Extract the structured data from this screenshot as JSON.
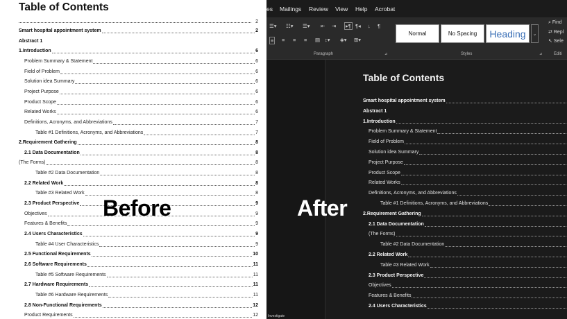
{
  "left": {
    "title": "Table of Contents",
    "top_page": "2",
    "entries": [
      {
        "text": "Smart hospital appointment system",
        "page": "2",
        "level": 0,
        "bold": true,
        "dots": true
      },
      {
        "text": "Abstract 1",
        "page": "",
        "level": 0,
        "bold": true,
        "dots": false
      },
      {
        "text": "1.Introduction",
        "page": "6",
        "level": 0,
        "bold": true,
        "dots": true
      },
      {
        "text": "Problem Summary & Statement",
        "page": "6",
        "level": 1,
        "bold": false,
        "dots": true
      },
      {
        "text": "Field of Problem",
        "page": "6",
        "level": 1,
        "bold": false,
        "dots": true
      },
      {
        "text": "Solution idea Summary",
        "page": "6",
        "level": 1,
        "bold": false,
        "dots": true
      },
      {
        "text": "Project Purpose",
        "page": "6",
        "level": 1,
        "bold": false,
        "dots": true
      },
      {
        "text": "Product Scope",
        "page": "6",
        "level": 1,
        "bold": false,
        "dots": true
      },
      {
        "text": "Related Works",
        "page": "6",
        "level": 1,
        "bold": false,
        "dots": true
      },
      {
        "text": "Definitions, Acronyms, and Abbreviations",
        "page": "7",
        "level": 1,
        "bold": false,
        "dots": true
      },
      {
        "text": "Table #1 Definitions, Acronyms, and Abbreviations",
        "page": "7",
        "level": 2,
        "bold": false,
        "dots": true
      },
      {
        "text": "2.Requirement Gathering",
        "page": "8",
        "level": 0,
        "bold": true,
        "dots": true
      },
      {
        "text": "2.1  Data Documentation",
        "page": "8",
        "level": 1,
        "bold": true,
        "dots": true
      },
      {
        "text": "(The Forms)",
        "page": "8",
        "level": 0,
        "bold": false,
        "dots": true
      },
      {
        "text": "Table #2  Data Documentation",
        "page": "8",
        "level": 2,
        "bold": false,
        "dots": true
      },
      {
        "text": "2.2  Related Work",
        "page": "8",
        "level": 1,
        "bold": true,
        "dots": true
      },
      {
        "text": "Table #3  Related Work",
        "page": "8",
        "level": 2,
        "bold": false,
        "dots": true
      },
      {
        "text": "2.3  Product Perspective",
        "page": "9",
        "level": 1,
        "bold": true,
        "dots": true
      },
      {
        "text": "Objectives",
        "page": "9",
        "level": 1,
        "bold": false,
        "dots": true
      },
      {
        "text": "Features & Benefits",
        "page": "9",
        "level": 1,
        "bold": false,
        "dots": true
      },
      {
        "text": "2.4  Users Characteristics",
        "page": "9",
        "level": 1,
        "bold": true,
        "dots": true
      },
      {
        "text": "Table #4  User Characteristics",
        "page": "9",
        "level": 2,
        "bold": false,
        "dots": true
      },
      {
        "text": "2.5  Functional Requirements",
        "page": "10",
        "level": 1,
        "bold": true,
        "dots": true
      },
      {
        "text": "2.6  Software Requirements",
        "page": "11",
        "level": 1,
        "bold": true,
        "dots": true
      },
      {
        "text": "Table #5  Software Requirements",
        "page": "11",
        "level": 2,
        "bold": false,
        "dots": true
      },
      {
        "text": "2.7  Hardware Requirements",
        "page": "11",
        "level": 1,
        "bold": true,
        "dots": true
      },
      {
        "text": "Table #6  Hardware Requirements",
        "page": "11",
        "level": 2,
        "bold": false,
        "dots": true
      },
      {
        "text": "2.8  Non-Functional Requirements",
        "page": "12",
        "level": 1,
        "bold": true,
        "dots": true
      },
      {
        "text": "Product Requirements",
        "page": "12",
        "level": 1,
        "bold": false,
        "dots": true
      }
    ]
  },
  "before_label": "Before",
  "after_label": "After",
  "right": {
    "menu": [
      "es",
      "Mailings",
      "Review",
      "View",
      "Help",
      "Acrobat"
    ],
    "styles": {
      "normal": "Normal",
      "no_spacing": "No Spacing",
      "heading": "Heading"
    },
    "groups": {
      "paragraph": "Paragraph",
      "styles": "Styles",
      "editing": "Editi"
    },
    "editing": {
      "find": "Find",
      "replace": "Repl",
      "select": "Sele"
    },
    "title": "Table of Contents",
    "status": "Investigate",
    "entries": [
      {
        "text": "Smart hospital appointment system",
        "level": 0,
        "bold": true,
        "dots": true
      },
      {
        "text": "Abstract 1",
        "level": 0,
        "bold": true,
        "dots": false
      },
      {
        "text": "1.Introduction",
        "level": 0,
        "bold": true,
        "dots": true
      },
      {
        "text": "Problem Summary & Statement",
        "level": 1,
        "bold": false,
        "dots": true
      },
      {
        "text": "Field of Problem",
        "level": 1,
        "bold": false,
        "dots": true
      },
      {
        "text": "Solution idea Summary",
        "level": 1,
        "bold": false,
        "dots": true
      },
      {
        "text": "Project Purpose",
        "level": 1,
        "bold": false,
        "dots": true
      },
      {
        "text": "Product Scope",
        "level": 1,
        "bold": false,
        "dots": true
      },
      {
        "text": "Related Works",
        "level": 1,
        "bold": false,
        "dots": true
      },
      {
        "text": "Definitions, Acronyms, and Abbreviations",
        "level": 1,
        "bold": false,
        "dots": true
      },
      {
        "text": "Table #1 Definitions, Acronyms, and Abbreviations",
        "level": 2,
        "bold": false,
        "dots": true
      },
      {
        "text": "2.Requirement Gathering",
        "level": 0,
        "bold": true,
        "dots": true
      },
      {
        "text": "2.1  Data Documentation",
        "level": 1,
        "bold": true,
        "dots": true
      },
      {
        "text": "(The Forms)",
        "level": 1,
        "bold": false,
        "dots": true
      },
      {
        "text": "Table #2  Data Documentation",
        "level": 2,
        "bold": false,
        "dots": true
      },
      {
        "text": "2.2  Related Work",
        "level": 1,
        "bold": true,
        "dots": true
      },
      {
        "text": "Table #3  Related Work",
        "level": 2,
        "bold": false,
        "dots": true
      },
      {
        "text": "2.3  Product Perspective",
        "level": 1,
        "bold": true,
        "dots": true
      },
      {
        "text": "Objectives",
        "level": 1,
        "bold": false,
        "dots": true
      },
      {
        "text": "Features & Benefits",
        "level": 1,
        "bold": false,
        "dots": true
      },
      {
        "text": "2.4  Users Characteristics",
        "level": 1,
        "bold": true,
        "dots": true
      }
    ]
  }
}
